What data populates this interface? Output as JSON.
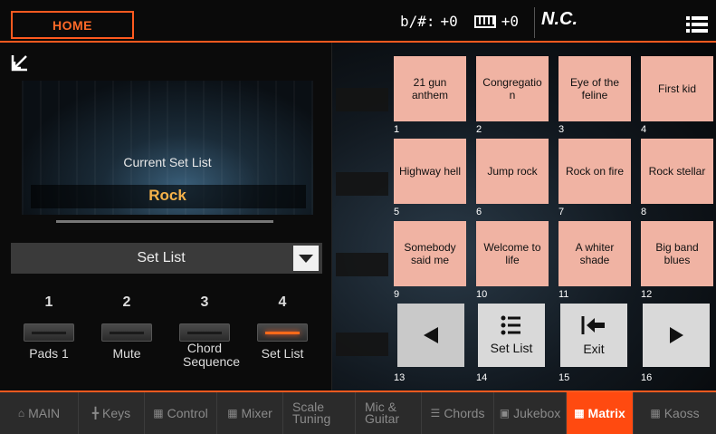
{
  "header": {
    "home_label": "HOME",
    "transpose_label": "b/#:",
    "transpose_value": "+0",
    "octave_value": "+0",
    "chord_name": "N.C."
  },
  "left_panel": {
    "current_set_list_label": "Current Set List",
    "current_set_list_name": "Rock",
    "dropdown_value": "Set List",
    "switches": [
      {
        "number": "1",
        "label": "Pads 1",
        "active": false
      },
      {
        "number": "2",
        "label": "Mute",
        "active": false
      },
      {
        "number": "3",
        "label": "Chord Sequence",
        "active": false
      },
      {
        "number": "4",
        "label": "Set List",
        "active": true
      }
    ]
  },
  "matrix": {
    "pads": [
      {
        "number": "1",
        "label": "21 gun anthem"
      },
      {
        "number": "2",
        "label": "Congregatio n"
      },
      {
        "number": "3",
        "label": "Eye of the feline"
      },
      {
        "number": "4",
        "label": "First kid"
      },
      {
        "number": "5",
        "label": "Highway hell"
      },
      {
        "number": "6",
        "label": "Jump rock"
      },
      {
        "number": "7",
        "label": "Rock on fire"
      },
      {
        "number": "8",
        "label": "Rock stellar"
      },
      {
        "number": "9",
        "label": "Somebody said me"
      },
      {
        "number": "10",
        "label": "Welcome to life"
      },
      {
        "number": "11",
        "label": "A whiter shade"
      },
      {
        "number": "12",
        "label": "Big band blues"
      }
    ],
    "controls": [
      {
        "number": "13",
        "label": "",
        "icon": "left-triangle-icon"
      },
      {
        "number": "14",
        "label": "Set List",
        "icon": "list-icon"
      },
      {
        "number": "15",
        "label": "Exit",
        "icon": "exit-arrow-icon"
      },
      {
        "number": "16",
        "label": "",
        "icon": "right-triangle-icon"
      }
    ]
  },
  "tabs": [
    {
      "label": "MAIN",
      "icon": "home-icon"
    },
    {
      "label": "Keys",
      "icon": "keys-icon"
    },
    {
      "label": "Control",
      "icon": "control-icon"
    },
    {
      "label": "Mixer",
      "icon": "mixer-icon"
    },
    {
      "label": "Scale",
      "label2": "Tuning",
      "icon": "scale-icon"
    },
    {
      "label": "Mic &",
      "label2": "Guitar",
      "icon": "mic-icon"
    },
    {
      "label": "Chords",
      "icon": "chords-icon"
    },
    {
      "label": "Jukebox",
      "icon": "jukebox-icon"
    },
    {
      "label": "Matrix",
      "icon": "matrix-icon",
      "active": true
    },
    {
      "label": "Kaoss",
      "icon": "kaoss-icon"
    }
  ],
  "colors": {
    "accent": "#ff5a1f",
    "pad": "#f0b3a3",
    "set_list_name": "#f6b24a"
  }
}
